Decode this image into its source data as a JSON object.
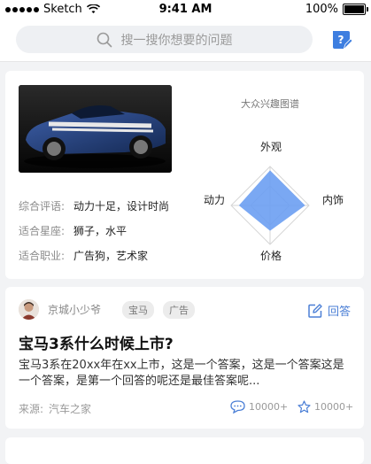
{
  "status_bar": {
    "carrier": "Sketch",
    "time": "9:41 AM",
    "battery": "100%"
  },
  "search": {
    "placeholder": "搜一搜你想要的问题"
  },
  "product_card": {
    "info": [
      {
        "key": "综合评语:",
        "value": "动力十足，设计时尚"
      },
      {
        "key": "适合星座:",
        "value": "狮子，水平"
      },
      {
        "key": "适合职业:",
        "value": "广告狗，艺术家"
      }
    ],
    "radar": {
      "title": "大众兴趣图谱",
      "axes": [
        "外观",
        "内饰",
        "价格",
        "动力"
      ],
      "values": [
        0.9,
        0.9,
        0.65,
        0.8
      ],
      "fill_color": "#6b9ef2"
    }
  },
  "question_card": {
    "username": "京城小少爷",
    "tags": [
      "宝马",
      "广告"
    ],
    "answer_label": "回答",
    "title": "宝马3系什么时候上市?",
    "body": "宝马3系在20xx年在xx上市，这是一个答案，这是一个答案这是一个答案，是第一个回答的呢还是最佳答案呢...",
    "source_label": "来源:",
    "source_value": "汽车之家",
    "comments": "10000+",
    "stars": "10000+"
  },
  "colors": {
    "accent": "#4b7fd6",
    "radar_fill": "#6b9ef2"
  },
  "icons": {
    "search": "search-icon",
    "ask": "question-icon",
    "answer": "edit-icon",
    "comment": "comment-icon",
    "star": "star-icon"
  }
}
